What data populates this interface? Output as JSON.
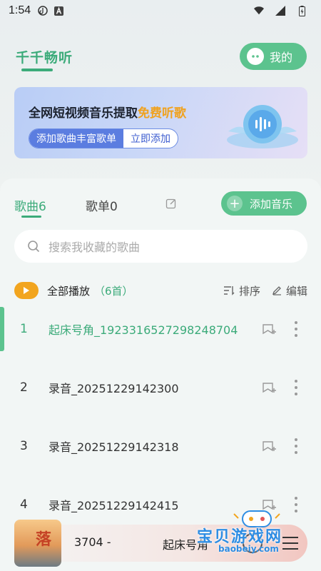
{
  "status_bar": {
    "time": "1:54",
    "icons": [
      "tiktok-icon",
      "a-icon",
      "wifi-icon",
      "signal-icon",
      "battery-icon"
    ]
  },
  "header": {
    "app_title": "千千畅听",
    "my_button_label": "我的"
  },
  "banner": {
    "title_main": "全网短视频音乐提取",
    "title_highlight": "免费听歌",
    "pill_left": "添加歌曲丰富歌单",
    "pill_right": "立即添加"
  },
  "tabs": {
    "songs": "歌曲6",
    "playlists": "歌单0",
    "add_music": "添加音乐"
  },
  "search": {
    "placeholder": "搜索我收藏的歌曲"
  },
  "play_all": {
    "label": "全部播放",
    "count": "（6首）",
    "sort_label": "排序",
    "edit_label": "编辑"
  },
  "songs": [
    {
      "index": "1",
      "title": "起床号角_1923316527298248704",
      "active": true
    },
    {
      "index": "2",
      "title": "录音_20251229142300",
      "active": false
    },
    {
      "index": "3",
      "title": "录音_20251229142318",
      "active": false
    },
    {
      "index": "4",
      "title": "录音_20251229142415",
      "active": false
    }
  ],
  "player": {
    "text_left": "3704 -",
    "text_right": "起床号角",
    "art_char": "落"
  },
  "watermark": {
    "name": "宝贝游戏网",
    "url": "baobeiy.com"
  },
  "colors": {
    "accent": "#5cc38e",
    "accent_text": "#3cab7a",
    "banner_highlight": "#f0a21f",
    "play_all": "#f2a51f"
  }
}
